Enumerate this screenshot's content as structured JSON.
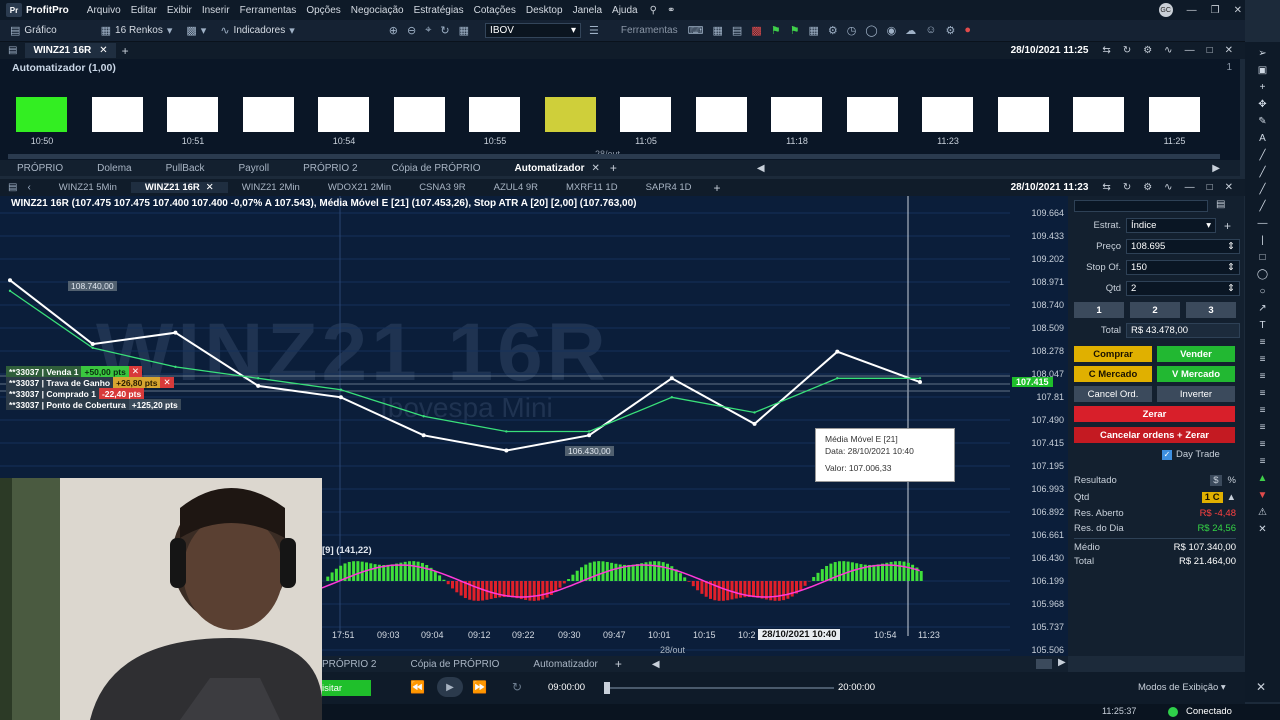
{
  "menubar": {
    "brand": "ProfitPro",
    "items": [
      "Arquivo",
      "Editar",
      "Exibir",
      "Inserir",
      "Ferramentas",
      "Opções",
      "Negociação",
      "Estratégias",
      "Cotações",
      "Desktop",
      "Janela",
      "Ajuda"
    ],
    "avatar": "GC"
  },
  "toolbar": {
    "grafico": "Gráfico",
    "renkos": "16 Renkos",
    "indicadores": "Indicadores",
    "symbol": "IBOV",
    "ferramentas": "Ferramentas"
  },
  "window1": {
    "tab": "WINZ21 16R",
    "datetime": "28/10/2021 11:25",
    "automator_title": "Automatizador (1,00)",
    "page_indicator": "1",
    "date_label": "28/out",
    "blocks": [
      {
        "color": "#33ee22",
        "time": "10:50"
      },
      {
        "color": "#ffffff",
        "time": ""
      },
      {
        "color": "#ffffff",
        "time": "10:51"
      },
      {
        "color": "#ffffff",
        "time": ""
      },
      {
        "color": "#ffffff",
        "time": "10:54"
      },
      {
        "color": "#ffffff",
        "time": ""
      },
      {
        "color": "#ffffff",
        "time": "10:55"
      },
      {
        "color": "#cfcf3a",
        "time": ""
      },
      {
        "color": "#ffffff",
        "time": "11:05"
      },
      {
        "color": "#ffffff",
        "time": ""
      },
      {
        "color": "#ffffff",
        "time": "11:18"
      },
      {
        "color": "#ffffff",
        "time": ""
      },
      {
        "color": "#ffffff",
        "time": "11:23"
      },
      {
        "color": "#ffffff",
        "time": ""
      },
      {
        "color": "#ffffff",
        "time": ""
      },
      {
        "color": "#ffffff",
        "time": "11:25"
      }
    ],
    "bottom_tabs": [
      "PRÓPRIO",
      "Dolema",
      "PullBack",
      "Payroll",
      "PRÓPRIO 2",
      "Cópia de PRÓPRIO",
      "Automatizador"
    ],
    "active_bottom_tab": "Automatizador"
  },
  "window2": {
    "tabs": [
      "WINZ21 5Min",
      "WINZ21 16R",
      "WINZ21 2Min",
      "WDOX21 2Min",
      "CSNA3 9R",
      "AZUL4 9R",
      "MXRF11 1D",
      "SAPR4 1D"
    ],
    "active_tab": "WINZ21 16R",
    "datetime": "28/10/2021 11:23"
  },
  "chart": {
    "header_main": "WINZ21 16R (107.475  107.475  107.400  107.400  -0,07%  A 107.543), Média Móvel E [21] (107.453,26), Stop ATR A [20] [2,00] (107.763,00)",
    "watermark": "WINZ21 16R",
    "watermark_sub": "Ibovespa Mini",
    "y_ticks": [
      "109.664",
      "109.433",
      "109.202",
      "108.971",
      "108.740",
      "108.509",
      "108.278",
      "108.047",
      "107.81",
      "107.490",
      "107.415",
      "107.195",
      "106.993",
      "106.892",
      "106.661",
      "106.430",
      "106.199",
      "105.968",
      "105.737",
      "105.506"
    ],
    "x_ticks": [
      "17:51",
      "09:03",
      "09:04",
      "09:12",
      "09:22",
      "09:30",
      "09:47",
      "10:01",
      "10:15",
      "10:2",
      "10:54",
      "11:23"
    ],
    "x_cursor_label": "28/10/2021 10:40",
    "x_date": "28/out",
    "price_high_label": "108.740,00",
    "price_low_label": "106.430,00",
    "last_price_label": "107.415",
    "osc_label": "[9] (141,22)",
    "orders": [
      {
        "id": "**33037 | Venda 1",
        "value": "+50,00 pts"
      },
      {
        "id": "**33037 | Trava de Ganho",
        "value": "+26,80 pts"
      },
      {
        "id": "**33037 | Comprado 1",
        "value": "-22,40 pts"
      },
      {
        "id": "**33037 | Ponto de Cobertura",
        "value": "+125,20 pts"
      }
    ],
    "tooltip": {
      "title": "Média Móvel E [21]",
      "date": "Data: 28/10/2021 10:40",
      "value": "Valor: 107.006,33"
    }
  },
  "chart_data": {
    "type": "line",
    "title": "WINZ21 16R",
    "ylim": [
      105.506,
      109.664
    ],
    "x": [
      "17:51",
      "09:03",
      "09:04",
      "09:12",
      "09:22",
      "09:30",
      "09:47",
      "10:01",
      "10:15",
      "10:2",
      "10:54",
      "11:23"
    ],
    "series": [
      {
        "name": "WINZ21 16R",
        "values": [
          108.74,
          107.9,
          108.05,
          107.35,
          107.2,
          106.7,
          106.5,
          106.7,
          107.45,
          106.85,
          107.8,
          107.4
        ]
      },
      {
        "name": "Média Móvel E [21]",
        "values": [
          108.6,
          107.85,
          107.6,
          107.45,
          107.3,
          106.95,
          106.75,
          106.75,
          107.2,
          107.0,
          107.45,
          107.45
        ]
      }
    ]
  },
  "boleta": {
    "estrat_label": "Estrat.",
    "estrat_value": "Índice",
    "preco_label": "Preço",
    "preco_value": "108.695",
    "stop_label": "Stop Of.",
    "stop_value": "150",
    "qtd_label": "Qtd",
    "qtd_value": "2",
    "presets": [
      "1",
      "2",
      "3"
    ],
    "total_label": "Total",
    "total_value": "R$ 43.478,00",
    "comprar": "Comprar",
    "vender": "Vender",
    "c_mercado": "C Mercado",
    "v_mercado": "V Mercado",
    "cancel_ord": "Cancel Ord.",
    "inverter": "Inverter",
    "zerar": "Zerar",
    "cancelar_zerar": "Cancelar ordens + Zerar",
    "day_trade": "Day Trade",
    "resultado_label": "Resultado",
    "qtd2_label": "Qtd",
    "qtd2_value": "1 C",
    "res_aberto_label": "Res. Aberto",
    "res_aberto_value": "R$ -4,48",
    "res_dia_label": "Res. do Dia",
    "res_dia_value": "R$ 24,56",
    "medio_label": "Médio",
    "medio_value": "R$ 107.340,00",
    "total2_label": "Total",
    "total2_value": "R$ 21.464,00"
  },
  "panel2": {
    "tabs": [
      "PRÓPRIO 2",
      "Cópia de PRÓPRIO",
      "Automatizador"
    ]
  },
  "playbar": {
    "btn": "isitar",
    "start_time": "09:00:00",
    "end_time": "20:00:00",
    "modos": "Modos de Exibição"
  },
  "statusbar": {
    "clock": "11:25:37",
    "status": "Conectado"
  }
}
